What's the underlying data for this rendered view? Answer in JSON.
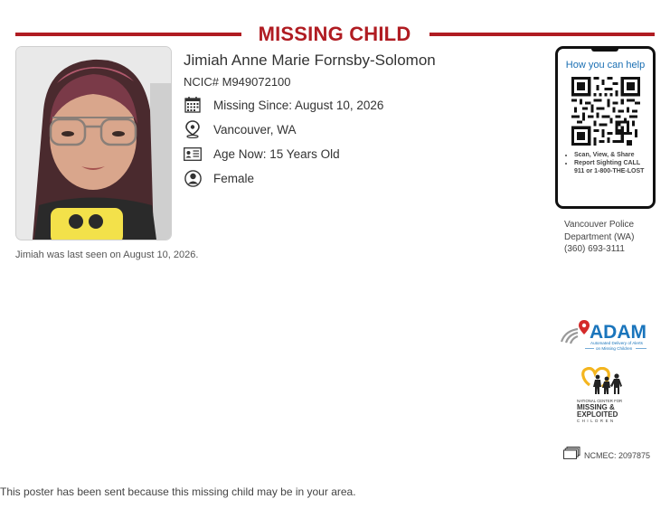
{
  "header": {
    "title": "MISSING CHILD"
  },
  "child": {
    "name": "Jimiah Anne Marie Fornsby-Solomon",
    "ncic": "NCIC# M949072100",
    "missing_since": "Missing Since: August 10, 2026",
    "location": "Vancouver, WA",
    "age": "Age Now: 15 Years Old",
    "sex": "Female"
  },
  "caption": "Jimiah was last seen on August 10, 2026.",
  "phone": {
    "help_text": "How you can help",
    "bullets": [
      "Scan, View, & Share",
      "Report Sighting CALL 911 or 1-800-THE-LOST"
    ]
  },
  "agency": {
    "line1": "Vancouver Police",
    "line2": "Department (WA)",
    "phone": "(360) 693-3111"
  },
  "logos": {
    "adam_word": "ADAM",
    "adam_tag1": "Automated Delivery of Alerts",
    "adam_tag2": "on Missing Children",
    "ncmec_line1": "NATIONAL CENTER FOR",
    "ncmec_line2": "MISSING &",
    "ncmec_line3": "EXPLOITED",
    "ncmec_line4": "CHILDREN"
  },
  "ncmec_case": "NCMEC: 2097875",
  "footer": "This poster has been sent because this missing child may be in your area.",
  "colors": {
    "accent": "#b01c22",
    "link": "#1a6fb3",
    "adam_blue": "#1a75bc",
    "ncmec_gold": "#f4b51e"
  },
  "icons": {
    "calendar": "calendar-icon",
    "location": "location-pin-icon",
    "id_card": "id-card-icon",
    "person": "person-icon",
    "cards": "cards-icon"
  }
}
